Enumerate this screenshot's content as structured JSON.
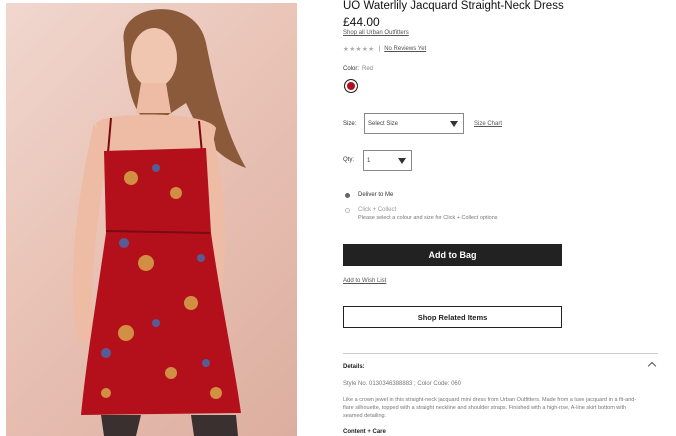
{
  "product": {
    "title": "UO Waterlily Jacquard Straight-Neck Dress",
    "price": "£44.00",
    "shop_all": "Shop all Urban Outfitters",
    "stars": "★★★★★",
    "rating_sep": "|",
    "reviews_link": "No Reviews Yet"
  },
  "color": {
    "label": "Color:",
    "value": "Red",
    "swatch_hex": "#b3101b"
  },
  "size": {
    "label": "Size:",
    "selected": "Select Size",
    "chart_link": "Size Chart"
  },
  "qty": {
    "label": "Qty:",
    "selected": "1"
  },
  "delivery": {
    "deliver": "Deliver to Me",
    "collect": "Click + Collect",
    "collect_note": "Please select a colour and size for Click + Collect options"
  },
  "actions": {
    "add_to_bag": "Add to Bag",
    "wish_list": "Add to Wish List",
    "shop_related": "Shop Related Items"
  },
  "details": {
    "heading": "Details:",
    "style_no": "Style No. 0130346388883 ; Color Code: 060",
    "description": "Like a crown jewel in this straight-neck jacquard mini dress from Urban Outfitters. Made from a luxe jacquard in a fit-and-flare silhouette, topped with a straight neckline and shoulder straps. Finished with a high-rise, A-line skirt bottom with seamed detailing.",
    "content_care": "Content + Care"
  },
  "colors": {
    "button_bg": "#222222",
    "dress_red": "#b3101b"
  }
}
